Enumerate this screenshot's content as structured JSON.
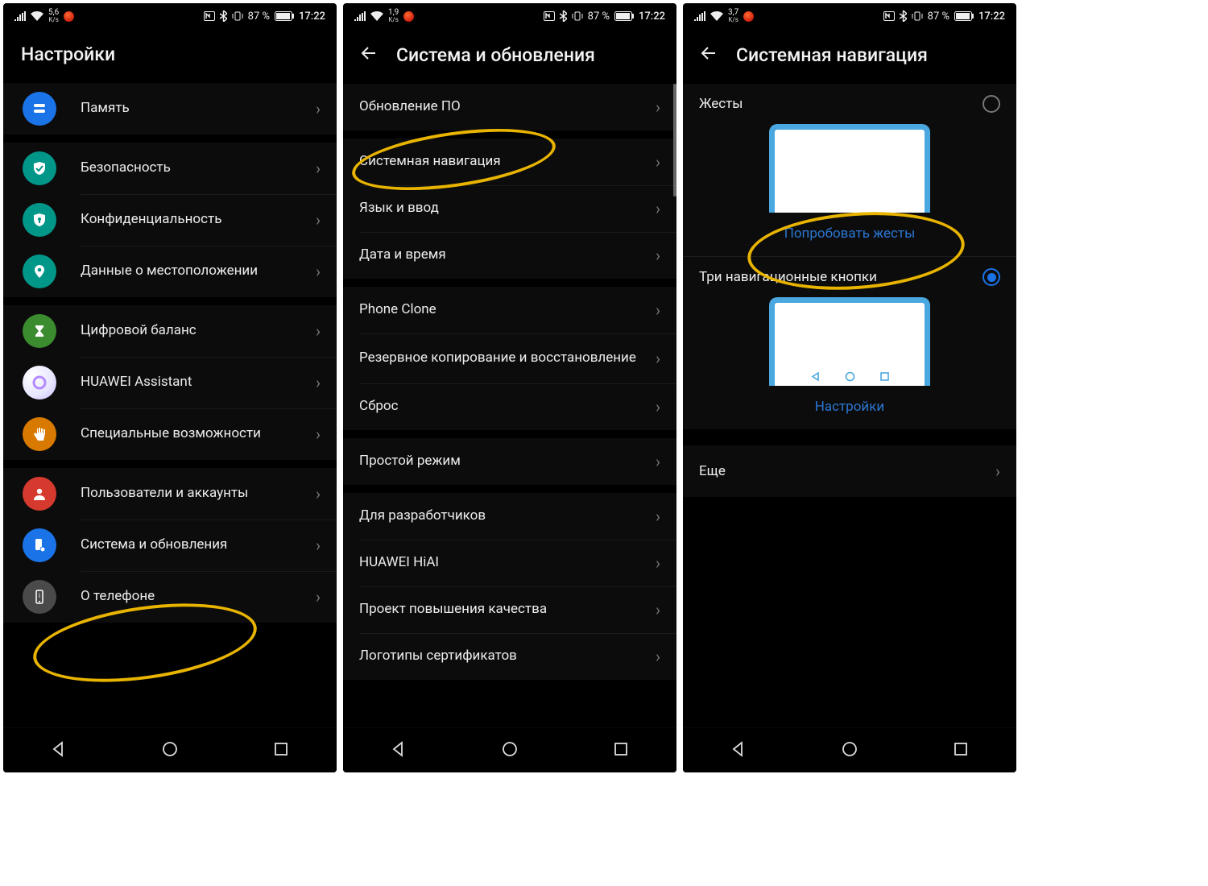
{
  "status": {
    "battery_text": "87 %",
    "time": "17:22"
  },
  "screens": [
    {
      "speed": "5,6",
      "speed_unit": "K/s",
      "title": "Настройки",
      "rows": [
        {
          "label": "Память"
        },
        {
          "label": "Безопасность"
        },
        {
          "label": "Конфиденциальность"
        },
        {
          "label": "Данные о местоположении"
        },
        {
          "label": "Цифровой баланс"
        },
        {
          "label": "HUAWEI Assistant"
        },
        {
          "label": "Специальные возможности"
        },
        {
          "label": "Пользователи и аккаунты"
        },
        {
          "label": "Система и обновления"
        },
        {
          "label": "О телефоне"
        }
      ]
    },
    {
      "speed": "1,9",
      "speed_unit": "K/s",
      "title": "Система и обновления",
      "rows": [
        {
          "label": "Обновление ПО"
        },
        {
          "label": "Системная навигация"
        },
        {
          "label": "Язык и ввод"
        },
        {
          "label": "Дата и время"
        },
        {
          "label": "Phone Clone"
        },
        {
          "label": "Резервное копирование и восстановление"
        },
        {
          "label": "Сброс"
        },
        {
          "label": "Простой режим"
        },
        {
          "label": "Для разработчиков"
        },
        {
          "label": "HUAWEI HiAI"
        },
        {
          "label": "Проект повышения качества"
        },
        {
          "label": "Логотипы сертификатов"
        }
      ]
    },
    {
      "speed": "3,7",
      "speed_unit": "K/s",
      "title": "Системная навигация",
      "options": [
        {
          "label": "Жесты",
          "action": "Попробовать жесты",
          "selected": false
        },
        {
          "label": "Три навигационные кнопки",
          "action": "Настройки",
          "selected": true
        }
      ],
      "more": "Еще"
    }
  ]
}
